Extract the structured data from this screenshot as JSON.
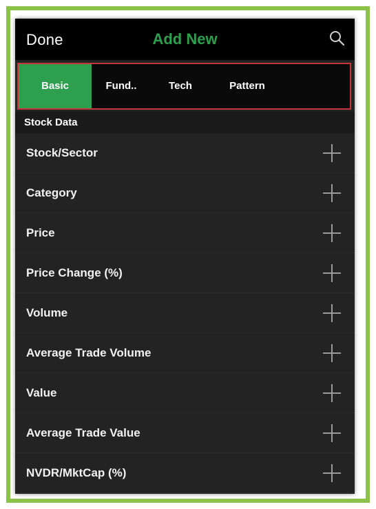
{
  "header": {
    "done_label": "Done",
    "title": "Add New",
    "search_icon": "search-icon"
  },
  "tabs": [
    {
      "label": "Basic",
      "active": true
    },
    {
      "label": "Fund..",
      "active": false
    },
    {
      "label": "Tech",
      "active": false
    },
    {
      "label": "Pattern",
      "active": false
    }
  ],
  "section": {
    "title": "Stock Data"
  },
  "items": [
    {
      "label": "Stock/Sector",
      "icon": "plus-icon"
    },
    {
      "label": "Category",
      "icon": "plus-icon"
    },
    {
      "label": "Price",
      "icon": "plus-icon"
    },
    {
      "label": "Price Change (%)",
      "icon": "plus-icon"
    },
    {
      "label": "Volume",
      "icon": "plus-icon"
    },
    {
      "label": "Average Trade Volume",
      "icon": "plus-icon"
    },
    {
      "label": "Value",
      "icon": "plus-icon"
    },
    {
      "label": "Average Trade Value",
      "icon": "plus-icon"
    },
    {
      "label": "NVDR/MktCap (%)",
      "icon": "plus-icon"
    }
  ],
  "colors": {
    "frame_border": "#8BC34A",
    "accent_green": "#2E9E4F",
    "tab_border": "#C8343B",
    "background": "#232323"
  }
}
